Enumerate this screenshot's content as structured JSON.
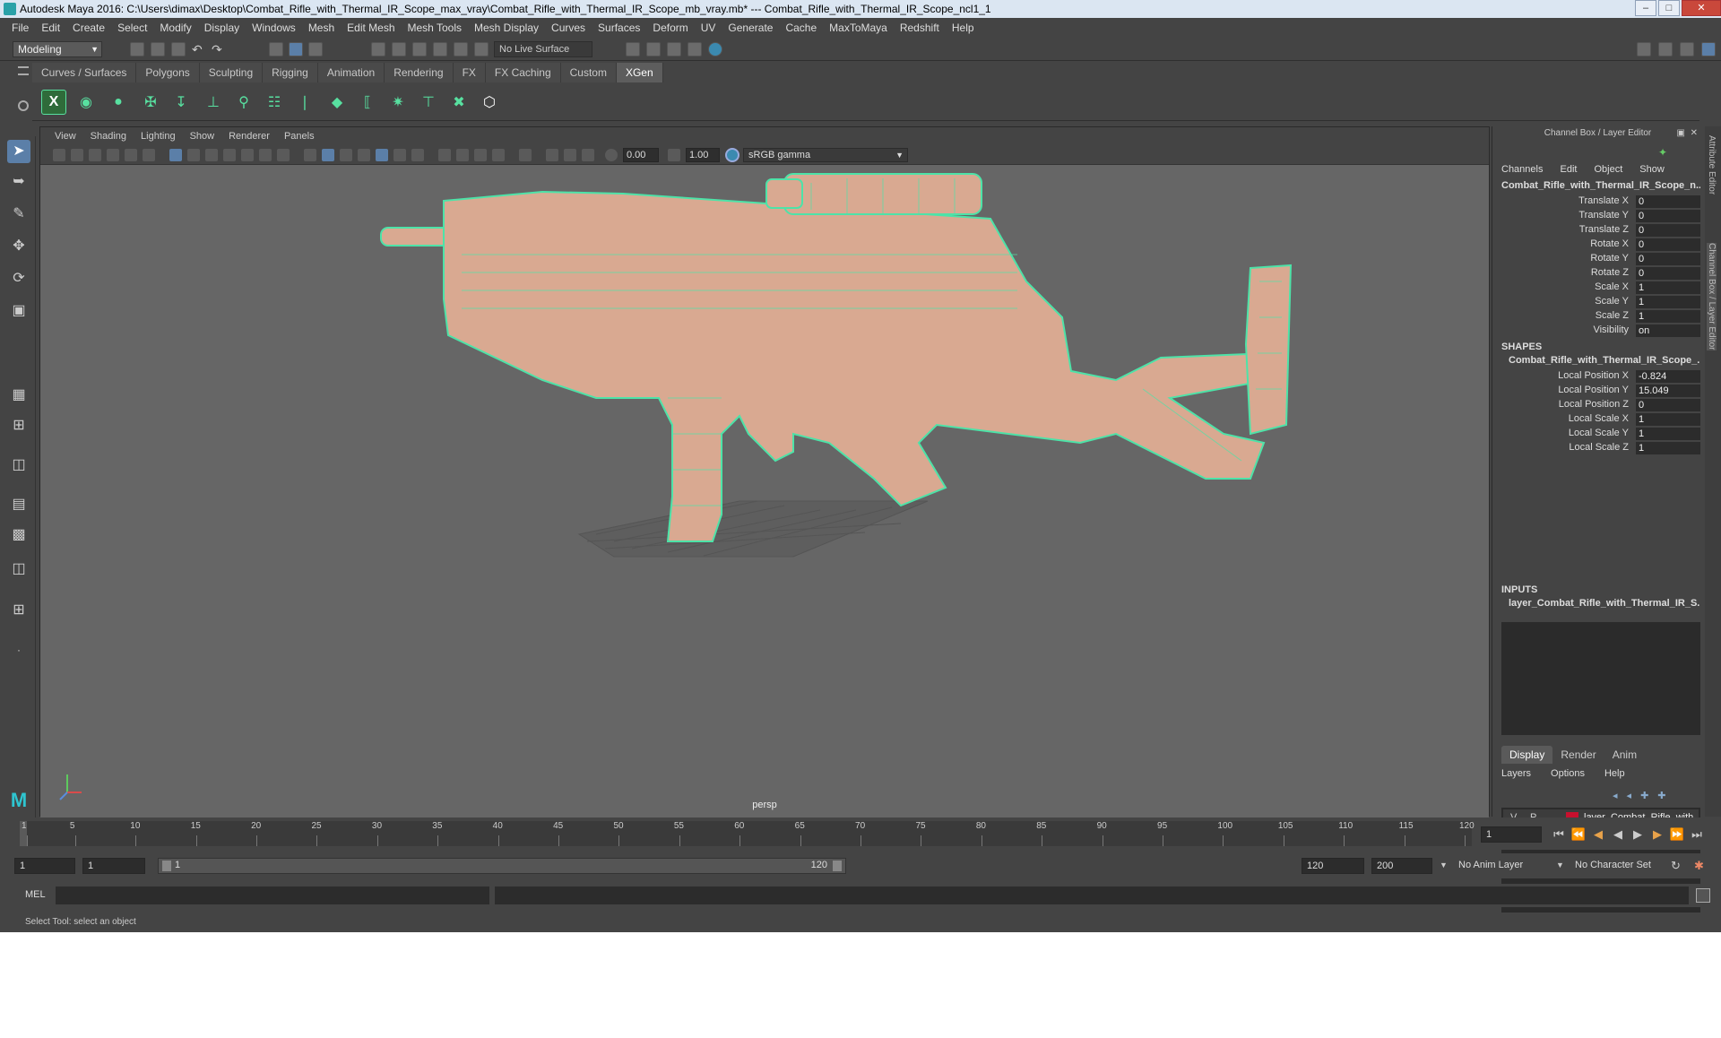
{
  "window": {
    "title": "Autodesk Maya 2016: C:\\Users\\dimax\\Desktop\\Combat_Rifle_with_Thermal_IR_Scope_max_vray\\Combat_Rifle_with_Thermal_IR_Scope_mb_vray.mb*   ---   Combat_Rifle_with_Thermal_IR_Scope_ncl1_1"
  },
  "menu": [
    "File",
    "Edit",
    "Create",
    "Select",
    "Modify",
    "Display",
    "Windows",
    "Mesh",
    "Edit Mesh",
    "Mesh Tools",
    "Mesh Display",
    "Curves",
    "Surfaces",
    "Deform",
    "UV",
    "Generate",
    "Cache",
    "MaxToMaya",
    "Redshift",
    "Help"
  ],
  "status_line": {
    "mode": "Modeling",
    "live_surface": "No Live Surface"
  },
  "shelf_tabs": [
    "Curves / Surfaces",
    "Polygons",
    "Sculpting",
    "Rigging",
    "Animation",
    "Rendering",
    "FX",
    "FX Caching",
    "Custom",
    "XGen"
  ],
  "active_shelf": "XGen",
  "panel_menu": [
    "View",
    "Shading",
    "Lighting",
    "Show",
    "Renderer",
    "Panels"
  ],
  "panel_toolbar": {
    "near": "0.00",
    "far": "1.00",
    "color_space": "sRGB gamma"
  },
  "viewport": {
    "camera": "persp",
    "wire_color": "#4de3a8"
  },
  "channel_box": {
    "title": "Channel Box / Layer Editor",
    "menu": [
      "Channels",
      "Edit",
      "Object",
      "Show"
    ],
    "object": "Combat_Rifle_with_Thermal_IR_Scope_n...",
    "attrs": [
      {
        "name": "Translate X",
        "value": "0"
      },
      {
        "name": "Translate Y",
        "value": "0"
      },
      {
        "name": "Translate Z",
        "value": "0"
      },
      {
        "name": "Rotate X",
        "value": "0"
      },
      {
        "name": "Rotate Y",
        "value": "0"
      },
      {
        "name": "Rotate Z",
        "value": "0"
      },
      {
        "name": "Scale X",
        "value": "1"
      },
      {
        "name": "Scale Y",
        "value": "1"
      },
      {
        "name": "Scale Z",
        "value": "1"
      },
      {
        "name": "Visibility",
        "value": "on"
      }
    ],
    "shapes_head": "SHAPES",
    "shape_name": "Combat_Rifle_with_Thermal_IR_Scope_...",
    "shape_attrs": [
      {
        "name": "Local Position X",
        "value": "-0.824"
      },
      {
        "name": "Local Position Y",
        "value": "15.049"
      },
      {
        "name": "Local Position Z",
        "value": "0"
      },
      {
        "name": "Local Scale X",
        "value": "1"
      },
      {
        "name": "Local Scale Y",
        "value": "1"
      },
      {
        "name": "Local Scale Z",
        "value": "1"
      }
    ],
    "inputs_head": "INPUTS",
    "input_name": "layer_Combat_Rifle_with_Thermal_IR_S..."
  },
  "layer_editor": {
    "tabs": [
      "Display",
      "Render",
      "Anim"
    ],
    "menu": [
      "Layers",
      "Options",
      "Help"
    ],
    "layer": {
      "v": "V",
      "p": "P",
      "color": "#c8102e",
      "name": "layer_Combat_Rifle_with"
    }
  },
  "right_strip": [
    "Attribute Editor",
    "Channel Box / Layer Editor"
  ],
  "timeline": {
    "ticks": [
      "1",
      "5",
      "10",
      "15",
      "20",
      "25",
      "30",
      "35",
      "40",
      "45",
      "50",
      "55",
      "60",
      "65",
      "70",
      "75",
      "80",
      "85",
      "90",
      "95",
      "100",
      "105",
      "110",
      "115",
      "120"
    ],
    "current_frame": "1"
  },
  "range": {
    "start": "1",
    "start_inner": "1",
    "slider_start": "1",
    "slider_end": "120",
    "end_inner": "120",
    "end": "200",
    "anim_layer": "No Anim Layer",
    "char_set": "No Character Set"
  },
  "command": {
    "label": "MEL"
  },
  "help_line": "Select Tool: select an object"
}
